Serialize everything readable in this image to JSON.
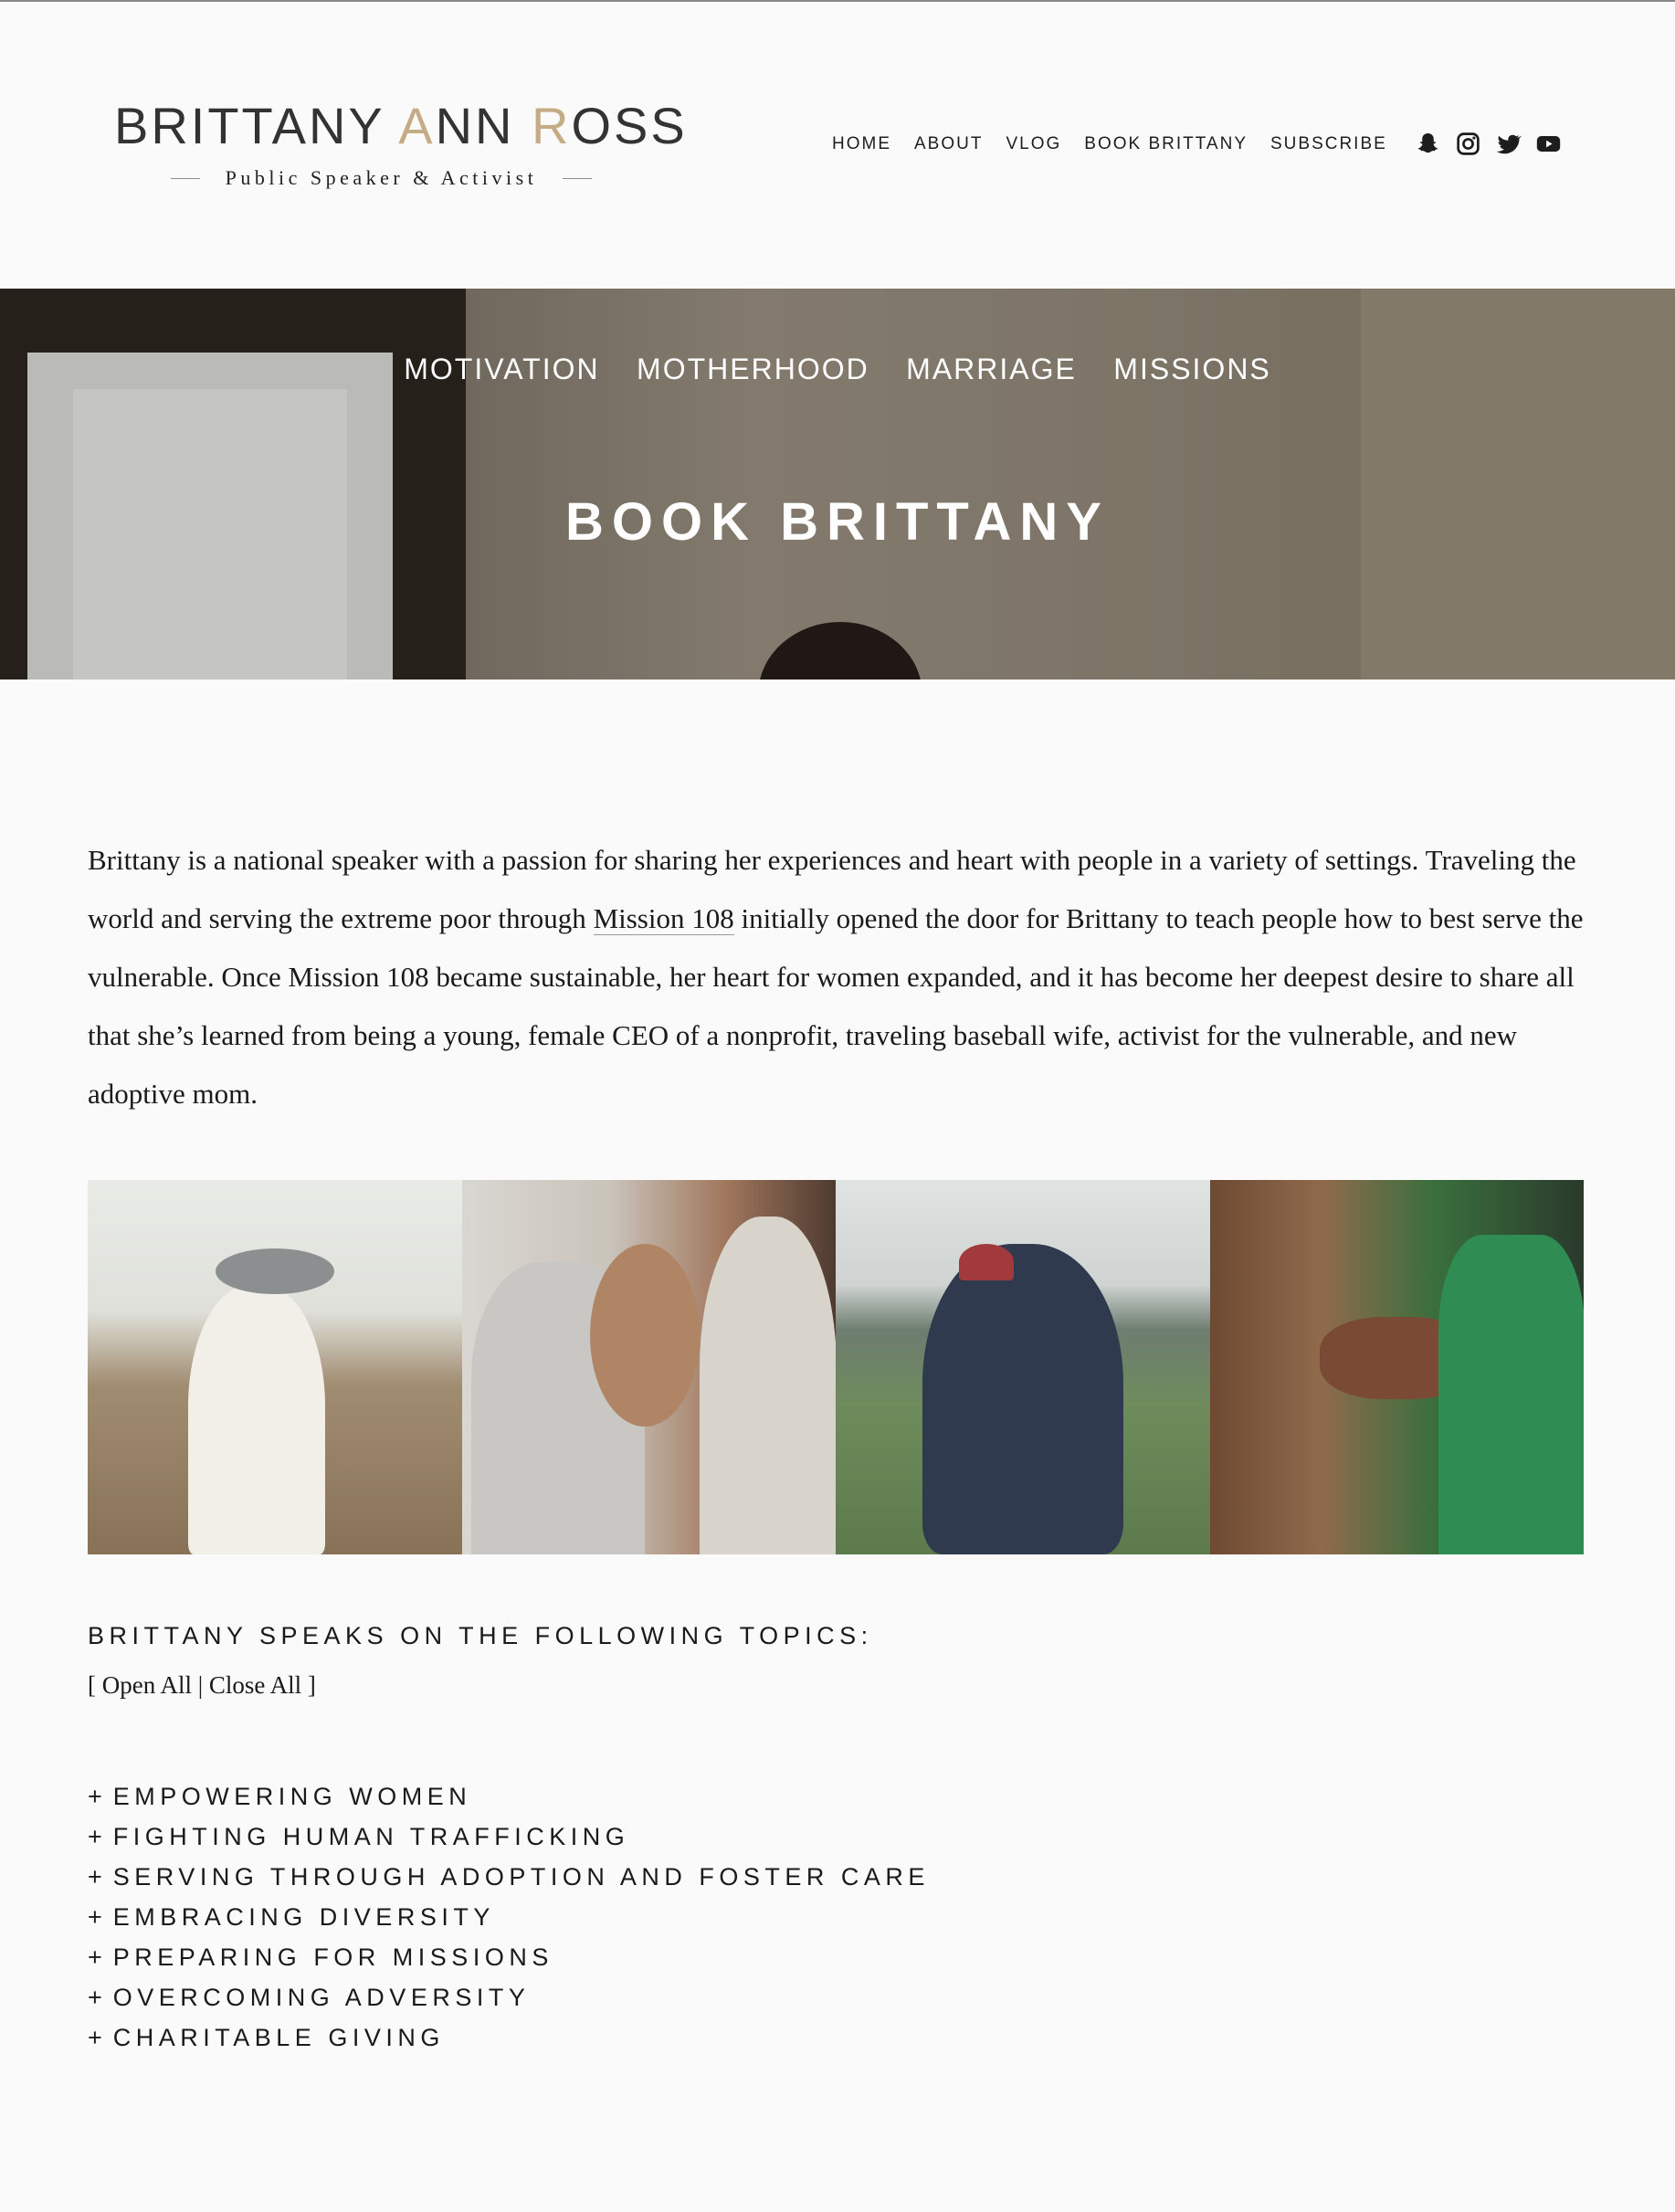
{
  "header": {
    "logo_name_part1": "BRITTANY ",
    "logo_name_a": "A",
    "logo_name_part2": "NN ",
    "logo_name_r": "R",
    "logo_name_part3": "OSS",
    "logo_tagline": "Public Speaker & Activist",
    "accent_color": "#c6ac86",
    "nav": [
      "HOME",
      "ABOUT",
      "VLOG",
      "BOOK BRITTANY",
      "SUBSCRIBE"
    ],
    "social_icons": [
      "snapchat-icon",
      "instagram-icon",
      "twitter-icon",
      "youtube-icon"
    ]
  },
  "hero": {
    "categories": [
      "MOTIVATION",
      "MOTHERHOOD",
      "MARRIAGE",
      "MISSIONS"
    ],
    "title": "BOOK BRITTANY"
  },
  "intro": {
    "before_link": "Brittany is a national speaker with a passion for sharing her experiences and heart with people in a variety of settings. Traveling the world and serving the extreme poor through ",
    "link": "Mission 108",
    "after_link": " initially opened the door for Brittany to teach people how to best serve the vulnerable. Once Mission 108 became sustainable, her heart for women expanded, and it has become her deepest desire to share all that she’s learned from being a young, female CEO of a nonprofit, traveling baseball wife, activist for the vulnerable, and new adoptive mom."
  },
  "topics": {
    "heading": "BRITTANY SPEAKS ON THE FOLLOWING TOPICS:",
    "toggle_open_bracket": "[ ",
    "open_all": "Open All",
    "separator": " | ",
    "close_all": "Close All",
    "toggle_close_bracket": " ]",
    "plus": "+",
    "items": [
      "EMPOWERING WOMEN",
      "FIGHTING HUMAN TRAFFICKING",
      "SERVING THROUGH ADOPTION AND FOSTER CARE",
      "EMBRACING DIVERSITY",
      "PREPARING FOR MISSIONS",
      "OVERCOMING ADVERSITY",
      "CHARITABLE GIVING"
    ]
  }
}
